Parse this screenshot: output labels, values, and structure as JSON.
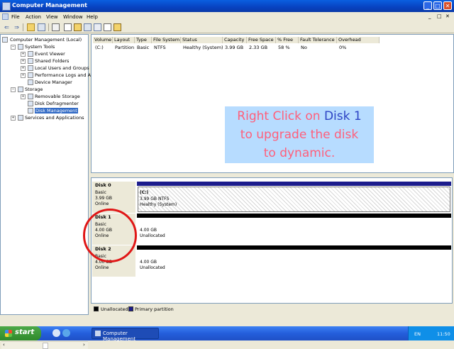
{
  "window": {
    "title": "Computer Management",
    "minimize": "_",
    "maximize": "□",
    "close": "✕"
  },
  "menu": [
    "File",
    "Action",
    "View",
    "Window",
    "Help"
  ],
  "inner_controls": [
    "_",
    "□",
    "✕"
  ],
  "toolbar": {
    "back": "⇐",
    "forward": "⇒",
    "icons": [
      "up-folder-icon",
      "show-tree-icon",
      "properties-icon",
      "help-icon",
      "delete-icon",
      "export-icon",
      "refresh-icon",
      "help-book-icon"
    ]
  },
  "tree": {
    "root": "Computer Management (Local)",
    "items": [
      {
        "label": "System Tools",
        "level": 1,
        "expander": "−"
      },
      {
        "label": "Event Viewer",
        "level": 2,
        "expander": "+"
      },
      {
        "label": "Shared Folders",
        "level": 2,
        "expander": "+"
      },
      {
        "label": "Local Users and Groups",
        "level": 2,
        "expander": "+"
      },
      {
        "label": "Performance Logs and Alerts",
        "level": 2,
        "expander": "+"
      },
      {
        "label": "Device Manager",
        "level": 2,
        "expander": ""
      },
      {
        "label": "Storage",
        "level": 1,
        "expander": "−"
      },
      {
        "label": "Removable Storage",
        "level": 2,
        "expander": "+"
      },
      {
        "label": "Disk Defragmenter",
        "level": 2,
        "expander": ""
      },
      {
        "label": "Disk Management",
        "level": 2,
        "expander": "",
        "selected": true
      },
      {
        "label": "Services and Applications",
        "level": 1,
        "expander": "+"
      }
    ]
  },
  "volumes": {
    "columns": [
      "Volume",
      "Layout",
      "Type",
      "File System",
      "Status",
      "Capacity",
      "Free Space",
      "% Free",
      "Fault Tolerance",
      "Overhead"
    ],
    "rows": [
      [
        "(C:)",
        "Partition",
        "Basic",
        "NTFS",
        "Healthy (System)",
        "3.99 GB",
        "2.33 GB",
        "58 %",
        "No",
        "0%"
      ]
    ]
  },
  "callout": {
    "line1a": "Right Click on ",
    "line1b": "Disk 1",
    "line2": "to upgrade the disk",
    "line3": "to dynamic."
  },
  "disks": [
    {
      "name": "Disk 0",
      "type": "Basic",
      "size": "3.99 GB",
      "status": "Online",
      "partition": {
        "label": "(C:)",
        "detail": "3.99 GB NTFS",
        "state": "Healthy (System)",
        "color": "#1c1c8c"
      }
    },
    {
      "name": "Disk 1",
      "type": "Basic",
      "size": "4.00 GB",
      "status": "Online",
      "partition": {
        "label": "",
        "detail": "4.00 GB",
        "state": "Unallocated",
        "color": "#000000"
      }
    },
    {
      "name": "Disk 2",
      "type": "Basic",
      "size": "4.00 GB",
      "status": "Online",
      "partition": {
        "label": "",
        "detail": "4.00 GB",
        "state": "Unallocated",
        "color": "#000000"
      }
    }
  ],
  "legend": [
    {
      "label": "Unallocated",
      "color": "#000000"
    },
    {
      "label": "Primary partition",
      "color": "#1c1c8c"
    }
  ],
  "taskbar": {
    "start": "start",
    "task": "Computer Management",
    "lang": "EN",
    "clock": "11:50"
  }
}
